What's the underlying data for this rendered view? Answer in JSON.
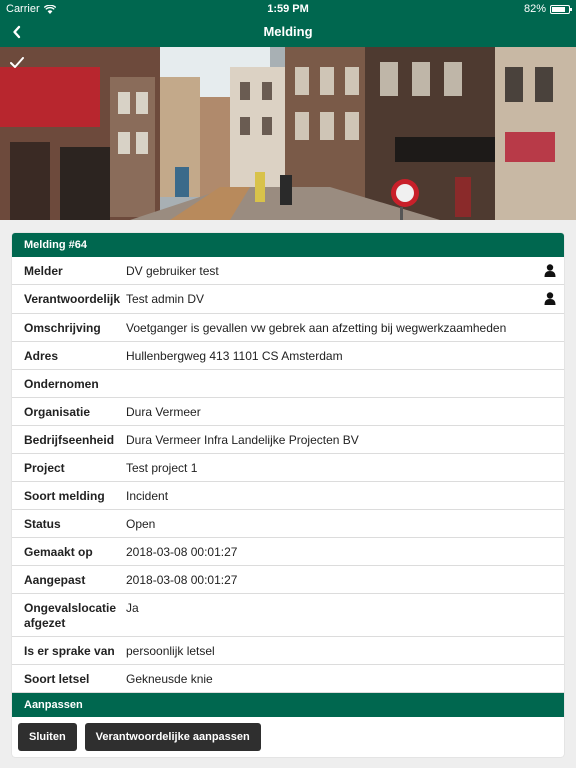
{
  "status_bar": {
    "carrier": "Carrier",
    "time": "1:59 PM",
    "battery": "82%",
    "battery_level": 0.82
  },
  "nav": {
    "title": "Melding",
    "back_icon": "chevron-left-icon"
  },
  "card": {
    "header": "Melding #64",
    "rows": [
      {
        "label": "Melder",
        "value": "DV gebruiker test",
        "icon": "person-icon"
      },
      {
        "label": "Verantwoordelijk",
        "value": "Test admin DV",
        "icon": "person-icon"
      },
      {
        "label": "Omschrijving",
        "value": "Voetganger is gevallen vw gebrek aan afzetting bij wegwerkzaamheden"
      },
      {
        "label": "Adres",
        "value": "Hullenbergweg 413 1101 CS Amsterdam"
      },
      {
        "label": "Ondernomen",
        "value": ""
      },
      {
        "label": "Organisatie",
        "value": "Dura Vermeer"
      },
      {
        "label": "Bedrijfseenheid",
        "value": "Dura Vermeer Infra Landelijke Projecten BV"
      },
      {
        "label": "Project",
        "value": "Test project 1"
      },
      {
        "label": "Soort melding",
        "value": "Incident"
      },
      {
        "label": "Status",
        "value": "Open"
      },
      {
        "label": "Gemaakt op",
        "value": "2018-03-08 00:01:27"
      },
      {
        "label": "Aangepast",
        "value": "2018-03-08 00:01:27"
      },
      {
        "label": "Ongevalslocatie afgezet",
        "value": "Ja"
      },
      {
        "label": "Is er sprake van",
        "value": "persoonlijk letsel"
      },
      {
        "label": "Soort letsel",
        "value": "Gekneusde knie"
      }
    ],
    "footer_header": "Aanpassen",
    "buttons": {
      "close": "Sluiten",
      "change_responsible": "Verantwoordelijke aanpassen"
    }
  },
  "colors": {
    "primary": "#00674f",
    "button": "#2f2f2f"
  }
}
